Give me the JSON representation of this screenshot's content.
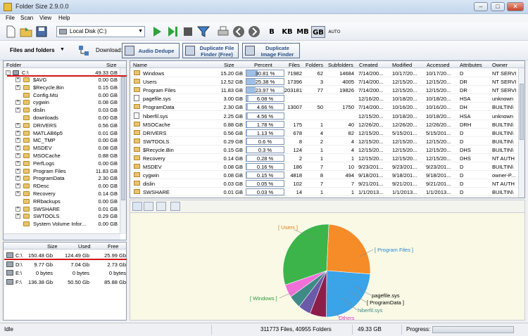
{
  "window": {
    "title": "Folder Size 2.9.0.0",
    "minimize": "–",
    "maximize": "□",
    "close": "✕"
  },
  "menu": [
    "File",
    "Scan",
    "View",
    "Help"
  ],
  "toolbar": {
    "drive_value": "Local Disk (C:)",
    "units": [
      "B",
      "KB",
      "MB",
      "GB",
      "AUTO"
    ],
    "active_unit": "GB"
  },
  "toolbar2": {
    "view_label": "Files and folders",
    "download_label": "Download:",
    "audio_dedupe": "Audio Dedupe",
    "dup_file_line1": "Duplicate File",
    "dup_file_line2": "Finder (Free)",
    "dup_image_line1": "Duplicate",
    "dup_image_line2": "Image Finder"
  },
  "tree": {
    "headers": {
      "folder": "Folder",
      "size": "Size"
    },
    "root": {
      "name": "C:\\",
      "size": "49.33 GB"
    },
    "items": [
      {
        "name": "$AVG",
        "size": "0.00 GB",
        "expand": true
      },
      {
        "name": "$Recycle.Bin",
        "size": "0.15 GB",
        "expand": true
      },
      {
        "name": "Config.Msi",
        "size": "0.00 GB",
        "expand": false
      },
      {
        "name": "cygwin",
        "size": "0.08 GB",
        "expand": true
      },
      {
        "name": "dislin",
        "size": "0.03 GB",
        "expand": true
      },
      {
        "name": "downloads",
        "size": "0.00 GB",
        "expand": false
      },
      {
        "name": "DRIVERS",
        "size": "0.56 GB",
        "expand": true
      },
      {
        "name": "MATLAB6p5",
        "size": "0.01 GB",
        "expand": true
      },
      {
        "name": "MC_TMP",
        "size": "0.00 GB",
        "expand": true
      },
      {
        "name": "MSDEV",
        "size": "0.08 GB",
        "expand": true
      },
      {
        "name": "MSOCache",
        "size": "0.88 GB",
        "expand": true
      },
      {
        "name": "PerfLogs",
        "size": "0.00 GB",
        "expand": true
      },
      {
        "name": "Program Files",
        "size": "11.83 GB",
        "expand": true
      },
      {
        "name": "ProgramData",
        "size": "2.30 GB",
        "expand": true
      },
      {
        "name": "RDesc",
        "size": "0.00 GB",
        "expand": true
      },
      {
        "name": "Recovery",
        "size": "0.14 GB",
        "expand": true
      },
      {
        "name": "RRbackups",
        "size": "0.00 GB",
        "expand": false
      },
      {
        "name": "SWSHARE",
        "size": "0.01 GB",
        "expand": true
      },
      {
        "name": "SWTOOLS",
        "size": "0.29 GB",
        "expand": true
      },
      {
        "name": "System Volume Infor...",
        "size": "0.00 GB",
        "expand": false
      }
    ]
  },
  "drives": {
    "headers": {
      "size": "Size",
      "used": "Used",
      "free": "Free"
    },
    "rows": [
      {
        "name": "C:\\",
        "size": "150.48 Gb",
        "used": "124.49 Gb",
        "free": "25.99 Gb"
      },
      {
        "name": "D:\\",
        "size": "9.77 Gb",
        "used": "7.04 Gb",
        "free": "2.73 Gb"
      },
      {
        "name": "E:\\",
        "size": "0 bytes",
        "used": "0 bytes",
        "free": "0 bytes"
      },
      {
        "name": "F:\\",
        "size": "136.38 Gb",
        "used": "50.50 Gb",
        "free": "85.88 Gb"
      }
    ]
  },
  "grid": {
    "headers": {
      "name": "Name",
      "size": "Size",
      "percent": "Percent",
      "files": "Files",
      "folders": "Folders",
      "subfolders": "Subfolders",
      "created": "Created",
      "modified": "Modified",
      "accessed": "Accessed",
      "attributes": "Attributes",
      "owner": "Owner"
    },
    "rows": [
      {
        "name": "Windows",
        "size": "15.20 GB",
        "percent": "30.81 %",
        "pct": 30.81,
        "files": "71982",
        "folders": "62",
        "subfolders": "14684",
        "created": "7/14/200...",
        "modified": "10/17/20...",
        "accessed": "10/17/20...",
        "attr": "D",
        "owner": "NT SERVI",
        "type": "folder"
      },
      {
        "name": "Users",
        "size": "12.52 GB",
        "percent": "25.38 %",
        "pct": 25.38,
        "files": "17396",
        "folders": "3",
        "subfolders": "4005",
        "created": "7/14/200...",
        "modified": "12/15/20...",
        "accessed": "12/15/20...",
        "attr": "DR",
        "owner": "NT SERVI",
        "type": "folder"
      },
      {
        "name": "Program Files",
        "size": "11.83 GB",
        "percent": "23.97 %",
        "pct": 23.97,
        "files": "203181",
        "folders": "77",
        "subfolders": "19826",
        "created": "7/14/200...",
        "modified": "12/15/20...",
        "accessed": "12/15/20...",
        "attr": "DR",
        "owner": "NT SERVI",
        "type": "folder"
      },
      {
        "name": "pagefile.sys",
        "size": "3.00 GB",
        "percent": "6.08 %",
        "pct": 6.08,
        "files": "",
        "folders": "",
        "subfolders": "",
        "created": "12/16/20...",
        "modified": "10/18/20...",
        "accessed": "10/18/20...",
        "attr": "HSA",
        "owner": "unknown",
        "type": "file"
      },
      {
        "name": "ProgramData",
        "size": "2.30 GB",
        "percent": "4.66 %",
        "pct": 4.66,
        "files": "13007",
        "folders": "50",
        "subfolders": "1750",
        "created": "7/14/200...",
        "modified": "10/16/20...",
        "accessed": "10/16/20...",
        "attr": "DH",
        "owner": "BUILTIN\\",
        "type": "folder"
      },
      {
        "name": "hiberfil.sys",
        "size": "2.25 GB",
        "percent": "4.56 %",
        "pct": 4.56,
        "files": "",
        "folders": "",
        "subfolders": "",
        "created": "12/15/20...",
        "modified": "10/18/20...",
        "accessed": "10/18/20...",
        "attr": "HSA",
        "owner": "unknown",
        "type": "file"
      },
      {
        "name": "MSOCache",
        "size": "0.88 GB",
        "percent": "1.78 %",
        "pct": 1.78,
        "files": "175",
        "folders": "1",
        "subfolders": "40",
        "created": "12/26/20...",
        "modified": "12/26/20...",
        "accessed": "12/26/20...",
        "attr": "DRH",
        "owner": "BUILTIN\\",
        "type": "folder"
      },
      {
        "name": "DRIVERS",
        "size": "0.56 GB",
        "percent": "1.13 %",
        "pct": 1.13,
        "files": "678",
        "folders": "4",
        "subfolders": "82",
        "created": "12/15/20...",
        "modified": "5/15/201...",
        "accessed": "5/15/201...",
        "attr": "D",
        "owner": "BUILTIN\\",
        "type": "folder"
      },
      {
        "name": "SWTOOLS",
        "size": "0.29 GB",
        "percent": "0.6 %",
        "pct": 0.6,
        "files": "8",
        "folders": "2",
        "subfolders": "4",
        "created": "12/15/20...",
        "modified": "12/15/20...",
        "accessed": "12/15/20...",
        "attr": "D",
        "owner": "BUILTIN\\",
        "type": "folder"
      },
      {
        "name": "$Recycle.Bin",
        "size": "0.15 GB",
        "percent": "0.3 %",
        "pct": 0.3,
        "files": "124",
        "folders": "1",
        "subfolders": "4",
        "created": "12/15/20...",
        "modified": "12/15/20...",
        "accessed": "12/15/20...",
        "attr": "DHS",
        "owner": "BUILTIN\\",
        "type": "folder"
      },
      {
        "name": "Recovery",
        "size": "0.14 GB",
        "percent": "0.28 %",
        "pct": 0.28,
        "files": "2",
        "folders": "1",
        "subfolders": "1",
        "created": "12/15/20...",
        "modified": "12/15/20...",
        "accessed": "12/15/20...",
        "attr": "DHS",
        "owner": "NT AUTH",
        "type": "folder"
      },
      {
        "name": "MSDEV",
        "size": "0.08 GB",
        "percent": "0.16 %",
        "pct": 0.16,
        "files": "186",
        "folders": "7",
        "subfolders": "10",
        "created": "9/23/201...",
        "modified": "9/23/201...",
        "accessed": "9/23/201...",
        "attr": "D",
        "owner": "BUILTIN\\",
        "type": "folder"
      },
      {
        "name": "cygwin",
        "size": "0.08 GB",
        "percent": "0.15 %",
        "pct": 0.15,
        "files": "4818",
        "folders": "8",
        "subfolders": "494",
        "created": "9/18/201...",
        "modified": "9/18/201...",
        "accessed": "9/18/201...",
        "attr": "D",
        "owner": "owner-P...",
        "type": "folder"
      },
      {
        "name": "dislin",
        "size": "0.03 GB",
        "percent": "0.05 %",
        "pct": 0.05,
        "files": "102",
        "folders": "7",
        "subfolders": "7",
        "created": "9/21/201...",
        "modified": "9/21/201...",
        "accessed": "9/21/201...",
        "attr": "D",
        "owner": "NT AUTH",
        "type": "folder"
      },
      {
        "name": "SWSHARE",
        "size": "0.01 GB",
        "percent": "0.03 %",
        "pct": 0.03,
        "files": "14",
        "folders": "1",
        "subfolders": "1",
        "created": "1/1/2013...",
        "modified": "1/1/2013...",
        "accessed": "1/1/2013...",
        "attr": "D",
        "owner": "BUILTIN\\",
        "type": "folder"
      }
    ]
  },
  "chart_data": {
    "type": "pie",
    "categories": [
      "[ Users ]",
      "[ Program Files ]",
      "pagefile.sys",
      "[ ProgramData ]",
      "hiberfil.sys",
      "Others",
      "[ Windows ]"
    ],
    "values": [
      25.38,
      23.97,
      6.08,
      4.66,
      4.56,
      4.55,
      30.81
    ],
    "colors": [
      "#f58c28",
      "#3ba3e8",
      "#8c1f4a",
      "#6a5aa8",
      "#3e8a86",
      "#f070d8",
      "#3cb44a"
    ]
  },
  "status": {
    "state": "Idle",
    "totals": "311773 Files, 40955 Folders",
    "size": "49.33 GB",
    "progress_label": "Progress:"
  }
}
